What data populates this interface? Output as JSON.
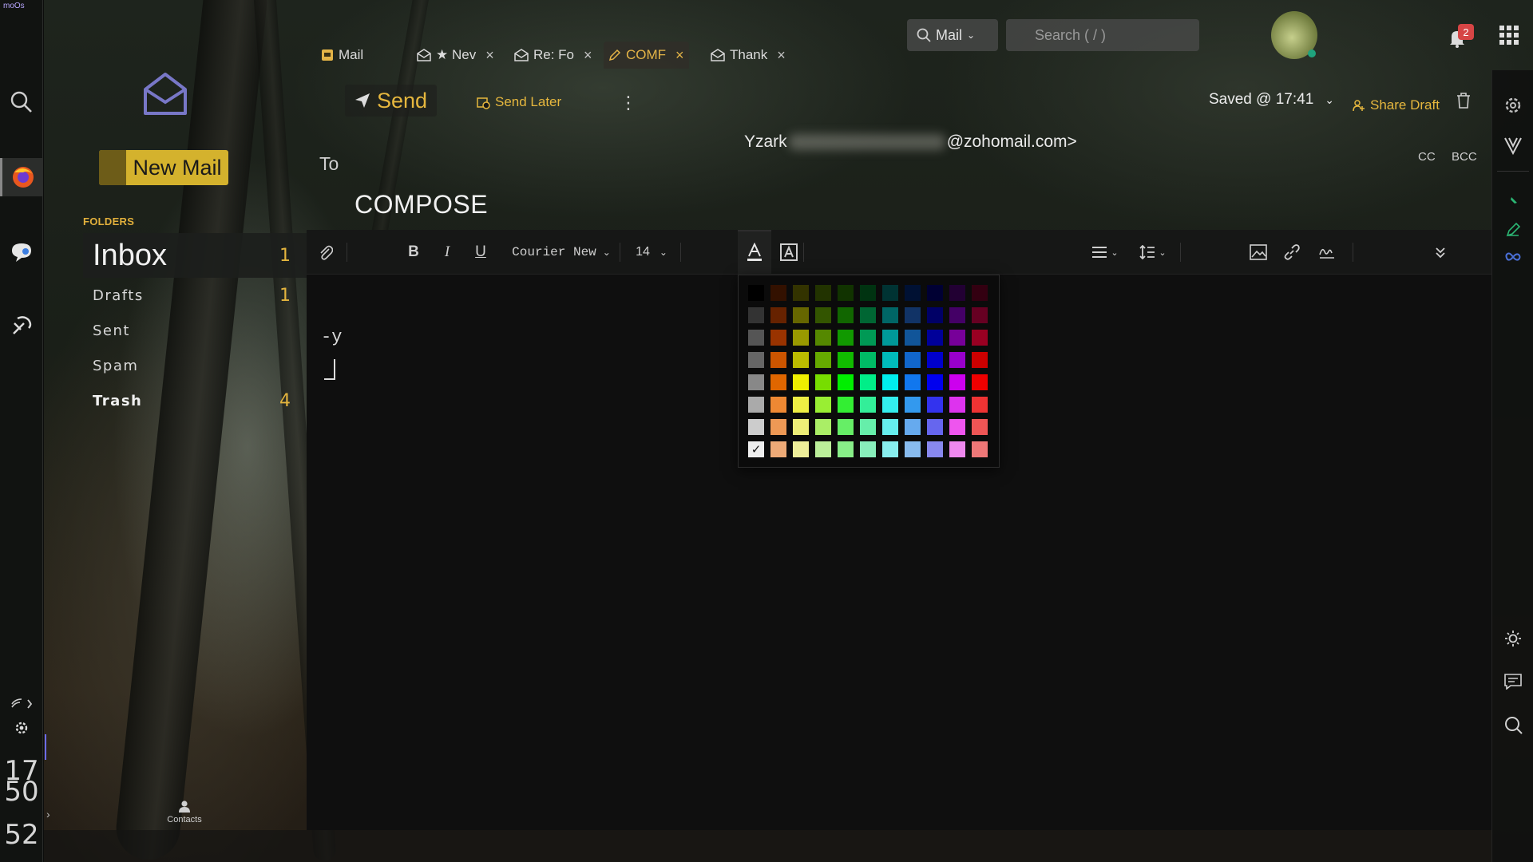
{
  "os": {
    "brand": "moOs",
    "clock": [
      "17",
      "50",
      "52"
    ]
  },
  "mail_panel": {
    "new_mail_label": "New Mail",
    "folders_heading": "FOLDERS",
    "folders": [
      {
        "name": "Inbox",
        "count": "1"
      },
      {
        "name": "Drafts",
        "count": "1"
      },
      {
        "name": "Sent",
        "count": ""
      },
      {
        "name": "Spam",
        "count": ""
      },
      {
        "name": "Trash",
        "count": "4"
      }
    ],
    "contacts_label": "Contacts"
  },
  "tabs": [
    {
      "label": "Mail"
    },
    {
      "label": "★ Nev"
    },
    {
      "label": "Re: Fo"
    },
    {
      "label": "COMF"
    },
    {
      "label": "Thank"
    }
  ],
  "search": {
    "scope": "Mail",
    "placeholder": "Search ( / )"
  },
  "notifications": {
    "count": "2"
  },
  "compose": {
    "send_label": "Send",
    "send_later_label": "Send Later",
    "saved_status": "Saved @ 17:41",
    "share_draft_label": "Share Draft",
    "to_label": "To",
    "recipient_prefix": "Yzark",
    "recipient_suffix": "@zohomail.com>",
    "cc_label": "CC",
    "bcc_label": "BCC",
    "subject": "COMPOSE",
    "font_family_value": "Courier New",
    "font_size_value": "14",
    "body_signature": "-y"
  },
  "palette": {
    "rows": [
      [
        "#000000",
        "#331100",
        "#333300",
        "#223300",
        "#113300",
        "#003311",
        "#003333",
        "#001133",
        "#000033",
        "#220033",
        "#330011"
      ],
      [
        "#333333",
        "#662200",
        "#666600",
        "#335500",
        "#116600",
        "#006633",
        "#006666",
        "#113366",
        "#000066",
        "#440066",
        "#660022"
      ],
      [
        "#555555",
        "#993300",
        "#999900",
        "#558800",
        "#119900",
        "#009955",
        "#009999",
        "#115599",
        "#000099",
        "#770099",
        "#990022"
      ],
      [
        "#666666",
        "#cc5500",
        "#bbbb00",
        "#66aa00",
        "#11bb00",
        "#00bb66",
        "#00bbbb",
        "#1166cc",
        "#0000cc",
        "#9900cc",
        "#cc0000"
      ],
      [
        "#888888",
        "#e06600",
        "#eeee00",
        "#77dd00",
        "#00ee00",
        "#00ee88",
        "#00eeee",
        "#1177ee",
        "#0000ee",
        "#cc00ee",
        "#ee0000"
      ],
      [
        "#aaaaaa",
        "#ee8833",
        "#eeee44",
        "#99ee33",
        "#33ee33",
        "#33ee99",
        "#33eeee",
        "#3399ee",
        "#3333ee",
        "#dd33ee",
        "#ee3333"
      ],
      [
        "#cccccc",
        "#ee9955",
        "#eeee77",
        "#aaee66",
        "#66ee66",
        "#66eeaa",
        "#66eeee",
        "#66aaee",
        "#6666ee",
        "#ee55ee",
        "#ee5555"
      ],
      [
        "#eeeeee",
        "#eeaa77",
        "#eeee99",
        "#bbee99",
        "#88ee88",
        "#88eebb",
        "#88eeee",
        "#88bbee",
        "#8888ee",
        "#ee88ee",
        "#ee7777"
      ]
    ],
    "selected": "#eeeeee",
    "check_glyph": "✓"
  },
  "accent_color": "#e4b447"
}
